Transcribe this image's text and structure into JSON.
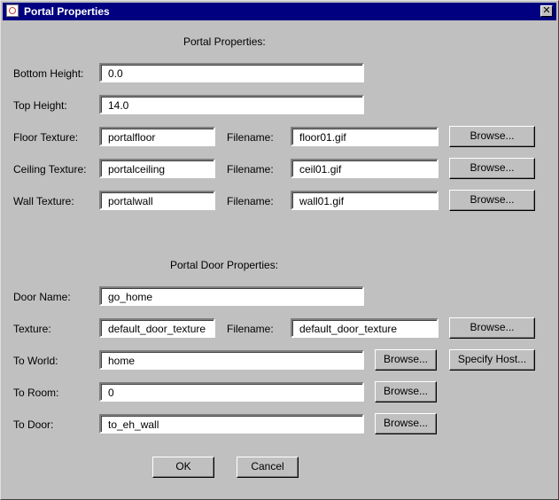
{
  "window": {
    "title": "Portal Properties",
    "close_glyph": "✕"
  },
  "portal": {
    "heading": "Portal Properties:",
    "bottom_height": {
      "label": "Bottom Height:",
      "value": "0.0"
    },
    "top_height": {
      "label": "Top Height:",
      "value": "14.0"
    },
    "floor": {
      "label": "Floor Texture:",
      "texture": "portalfloor",
      "filename_label": "Filename:",
      "filename": "floor01.gif",
      "browse": "Browse..."
    },
    "ceiling": {
      "label": "Ceiling Texture:",
      "texture": "portalceiling",
      "filename_label": "Filename:",
      "filename": "ceil01.gif",
      "browse": "Browse..."
    },
    "wall": {
      "label": "Wall Texture:",
      "texture": "portalwall",
      "filename_label": "Filename:",
      "filename": "wall01.gif",
      "browse": "Browse..."
    }
  },
  "door": {
    "heading": "Portal Door Properties:",
    "name": {
      "label": "Door Name:",
      "value": "go_home"
    },
    "texture": {
      "label": "Texture:",
      "value": "default_door_texture",
      "filename_label": "Filename:",
      "filename": "default_door_texture",
      "browse": "Browse..."
    },
    "to_world": {
      "label": "To World:",
      "value": "home",
      "browse": "Browse...",
      "specify_host": "Specify Host..."
    },
    "to_room": {
      "label": "To Room:",
      "value": "0",
      "browse": "Browse..."
    },
    "to_door": {
      "label": "To Door:",
      "value": "to_eh_wall",
      "browse": "Browse..."
    }
  },
  "buttons": {
    "ok": "OK",
    "cancel": "Cancel"
  },
  "icons": {
    "window_icon": "app-icon",
    "close": "close-icon"
  }
}
